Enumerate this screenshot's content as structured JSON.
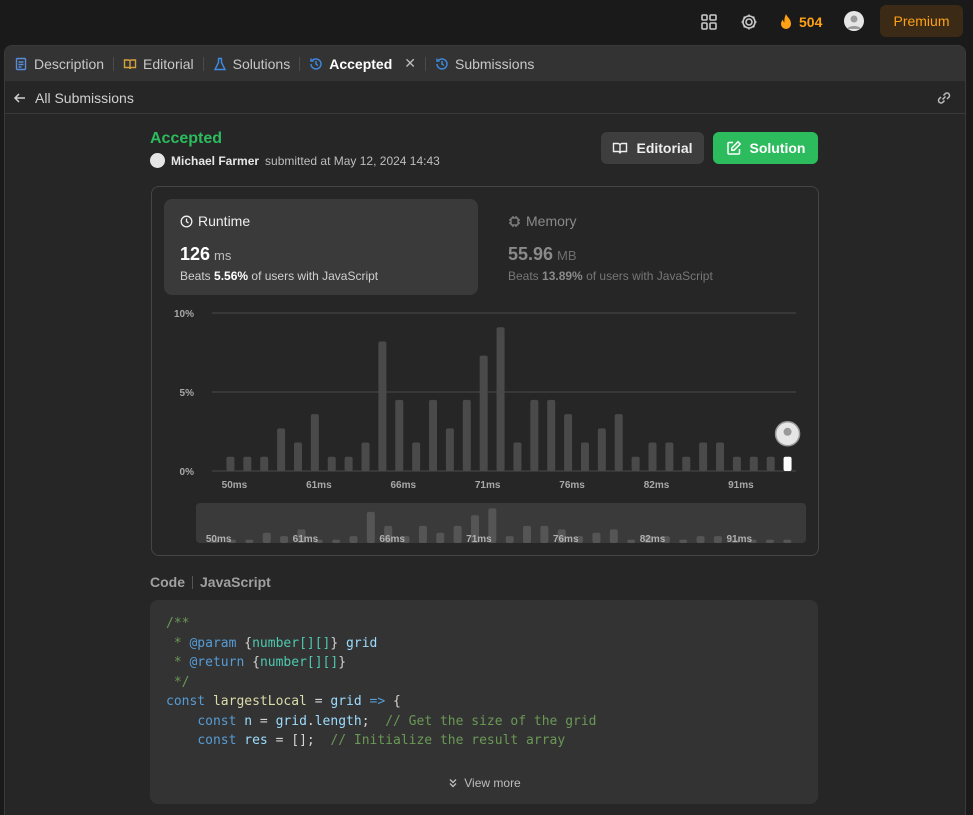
{
  "topbar": {
    "streak": "504",
    "premium_label": "Premium"
  },
  "tabs": [
    {
      "label": "Description",
      "icon": "document-icon",
      "color": "#5a8bd6"
    },
    {
      "label": "Editorial",
      "icon": "book-icon",
      "color": "#d4a13d"
    },
    {
      "label": "Solutions",
      "icon": "flask-icon",
      "color": "#3d8ce6"
    },
    {
      "label": "Accepted",
      "icon": "history-icon",
      "color": "#3d8ce6"
    },
    {
      "label": "Submissions",
      "icon": "history-icon",
      "color": "#3d8ce6"
    }
  ],
  "subbar": {
    "back_label": "All Submissions"
  },
  "submission": {
    "status": "Accepted",
    "user": "Michael Farmer",
    "submitted_text": "submitted at May 12, 2024 14:43",
    "editorial_label": "Editorial",
    "solution_label": "Solution",
    "status_color": "#2cbb5d"
  },
  "runtime": {
    "title": "Runtime",
    "value": "126",
    "unit": "ms",
    "beats_prefix": "Beats",
    "beats_value": "5.56%",
    "beats_suffix": "of users with JavaScript"
  },
  "memory": {
    "title": "Memory",
    "value": "55.96",
    "unit": "MB",
    "beats_prefix": "Beats",
    "beats_value": "13.89%",
    "beats_suffix": "of users with JavaScript"
  },
  "chart_data": {
    "type": "bar",
    "ylabels": [
      "10%",
      "5%",
      "0%"
    ],
    "ylim": [
      0,
      10
    ],
    "xticks": [
      "50ms",
      "61ms",
      "66ms",
      "71ms",
      "76ms",
      "82ms",
      "91ms"
    ],
    "values": [
      0.9,
      0.9,
      0.9,
      2.7,
      1.8,
      3.6,
      0.9,
      0.9,
      1.8,
      8.2,
      4.5,
      1.8,
      4.5,
      2.7,
      4.5,
      7.3,
      9.1,
      1.8,
      4.5,
      4.5,
      3.6,
      1.8,
      2.7,
      3.6,
      0.9,
      1.8,
      1.8,
      0.9,
      1.8,
      1.8,
      0.9,
      0.9,
      0.9,
      0.9
    ],
    "highlight_index": 33,
    "bar_color": "#4a4a4a",
    "highlight_color": "#ffffff"
  },
  "code": {
    "label": "Code",
    "language": "JavaScript",
    "lines": [
      "/**",
      " * @param {number[][]} grid",
      " * @return {number[][]}",
      " */",
      "const largestLocal = grid => {",
      "    const n = grid.length;  // Get the size of the grid",
      "    const res = [];  // Initialize the result array"
    ],
    "view_more": "View more"
  }
}
